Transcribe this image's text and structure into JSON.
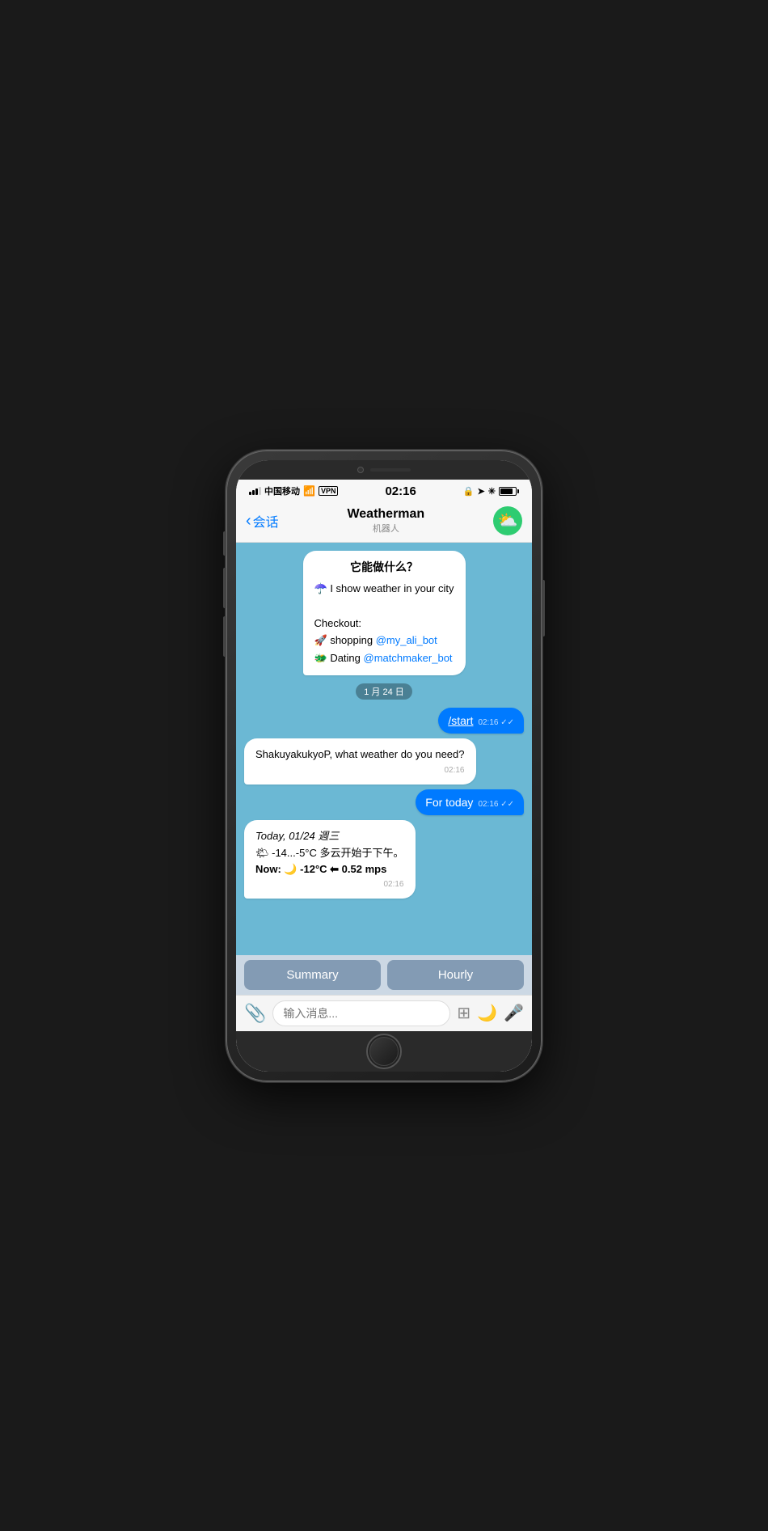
{
  "status": {
    "carrier": "中国移动",
    "time": "02:16",
    "vpn": "VPN"
  },
  "nav": {
    "back_label": "会话",
    "title": "Weatherman",
    "subtitle": "机器人"
  },
  "intro_bubble": {
    "title": "它能做什么？",
    "line1": "☂️ I show weather in your city",
    "checkout": "Checkout:",
    "item1_emoji": "🚀",
    "item1_text": " shopping ",
    "item1_link": "@my_ali_bot",
    "item2_emoji": "🐉",
    "item2_text": " Dating ",
    "item2_link": "@matchmaker_bot"
  },
  "date_badge": "1 月 24 日",
  "messages": [
    {
      "type": "user",
      "text": "/start",
      "time": "02:16",
      "ticks": "✓✓"
    },
    {
      "type": "bot",
      "text": "ShakuyakukyoP, what weather do you need?",
      "time": "02:16"
    },
    {
      "type": "user",
      "text": "For today",
      "time": "02:16",
      "ticks": "✓✓"
    },
    {
      "type": "bot",
      "lines": [
        "Today, 01/24 週三",
        "🌤 -14...-5°C 多云开始于下午。",
        "Now: 🌙 -12°C ⬅ 0.52 mps"
      ],
      "time": "02:16"
    }
  ],
  "action_buttons": [
    {
      "label": "Summary"
    },
    {
      "label": "Hourly"
    }
  ],
  "input": {
    "placeholder": "输入消息..."
  }
}
